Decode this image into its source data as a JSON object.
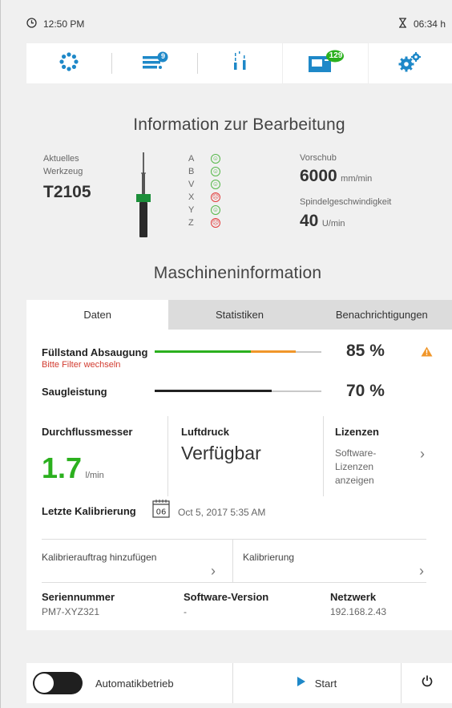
{
  "status": {
    "time": "12:50 PM",
    "runtime": "06:34 h"
  },
  "nav": {
    "items": [
      {
        "icon": "dots-circle-icon"
      },
      {
        "icon": "job-list-icon",
        "badge": "9"
      },
      {
        "icon": "spindle-tools-icon"
      },
      {
        "icon": "machine-icon",
        "badge": "129",
        "active": true
      },
      {
        "icon": "settings-gears-icon"
      }
    ],
    "colors": {
      "accent": "#1e88c8",
      "badge_blue": "#1e88c8",
      "badge_green": "#2bb01e"
    }
  },
  "processing": {
    "title": "Information zur Bearbeitung",
    "current_tool_label_1": "Aktuelles",
    "current_tool_label_2": "Werkzeug",
    "tool_code": "T2105",
    "axes": [
      {
        "name": "A",
        "state": "good"
      },
      {
        "name": "B",
        "state": "good"
      },
      {
        "name": "V",
        "state": "good"
      },
      {
        "name": "X",
        "state": "bad"
      },
      {
        "name": "Y",
        "state": "good"
      },
      {
        "name": "Z",
        "state": "bad"
      }
    ],
    "feed_label": "Vorschub",
    "feed_value": "6000",
    "feed_unit": "mm/min",
    "spindle_label": "Spindelgeschwindigkeit",
    "spindle_value": "40",
    "spindle_unit": "U/min"
  },
  "machine": {
    "title": "Maschineninformation",
    "tabs": [
      {
        "label": "Daten",
        "active": true
      },
      {
        "label": "Statistiken"
      },
      {
        "label": "Benachrichtigungen"
      }
    ],
    "suction_level_label": "Füllstand Absaugung",
    "suction_level_warning": "Bitte Filter wechseln",
    "suction_level_value": "85 %",
    "suction_level_fraction": 0.85,
    "suction_power_label": "Saugleistung",
    "suction_power_value": "70 %",
    "suction_power_fraction": 0.7,
    "flow_label": "Durchflussmesser",
    "flow_value": "1.7",
    "flow_unit": "l/min",
    "air_label": "Luftdruck",
    "air_value": "Verfügbar",
    "license_label": "Lizenzen",
    "license_line1": "Software-",
    "license_line2": "Lizenzen",
    "license_line3": "anzeigen",
    "calibration_label": "Letzte Kalibrierung",
    "calendar_day": "06",
    "calibration_date": "Oct 5, 2017 5:35 AM",
    "add_calibration_label": "Kalibrierauftrag hinzufügen",
    "calibration_link_label": "Kalibrierung",
    "serial_label": "Seriennummer",
    "serial_value": "PM7-XYZ321",
    "software_label": "Software-Version",
    "software_value": "-",
    "network_label": "Netzwerk",
    "network_value": "192.168.2.43"
  },
  "bottom": {
    "auto_label": "Automatikbetrieb",
    "start_label": "Start"
  }
}
